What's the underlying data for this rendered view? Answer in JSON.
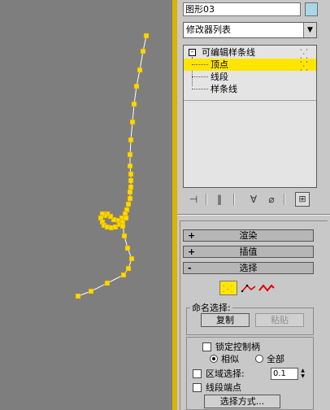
{
  "object_name": "图形03",
  "modifier_list": {
    "label": "修改器列表"
  },
  "stack": {
    "items": [
      {
        "label": "可编辑样条线",
        "toggle": "-"
      },
      {
        "label": "顶点"
      },
      {
        "label": "线段"
      },
      {
        "label": "样条线"
      }
    ]
  },
  "rollouts": [
    {
      "sign": "+",
      "label": "渲染"
    },
    {
      "sign": "+",
      "label": "插值"
    },
    {
      "sign": "-",
      "label": "选择"
    }
  ],
  "named_selection": {
    "title": "命名选择:",
    "copy_label": "复制",
    "paste_label": "粘贴"
  },
  "options": {
    "lock_handles": "锁定控制柄",
    "similar": "相似",
    "all": "全部",
    "area_select": "区域选择:",
    "area_value": "0.1",
    "segment_end": "线段端点",
    "select_by": "选择方式..."
  },
  "colors": {
    "viewport_bg": "#7e7e7e",
    "active_border": "#d6b400",
    "selection_yellow": "#ffe600",
    "vertex_color": "#ffd800",
    "spline_color": "#ffffff"
  },
  "curve": {
    "points": [
      [
        180,
        44
      ],
      [
        176,
        63
      ],
      [
        172,
        86
      ],
      [
        168,
        106
      ],
      [
        165,
        128
      ],
      [
        163,
        150
      ],
      [
        161,
        172
      ],
      [
        160,
        190
      ],
      [
        160,
        204
      ],
      [
        161,
        214
      ],
      [
        161,
        222
      ],
      [
        161,
        230
      ],
      [
        160,
        236
      ],
      [
        160,
        244
      ],
      [
        158,
        251
      ],
      [
        156,
        258
      ],
      [
        154,
        263
      ],
      [
        150,
        268
      ],
      [
        145,
        271
      ],
      [
        140,
        270
      ],
      [
        136,
        266
      ],
      [
        132,
        263
      ],
      [
        129,
        265
      ],
      [
        126,
        263
      ],
      [
        124,
        268
      ],
      [
        126,
        273
      ],
      [
        128,
        277
      ],
      [
        132,
        279
      ],
      [
        137,
        280
      ],
      [
        142,
        279
      ],
      [
        147,
        276
      ],
      [
        151,
        273
      ],
      [
        155,
        268
      ],
      [
        151,
        278
      ],
      [
        153,
        290
      ],
      [
        157,
        305
      ],
      [
        162,
        318
      ],
      [
        158,
        330
      ],
      [
        152,
        338
      ],
      [
        132,
        348
      ],
      [
        112,
        358
      ],
      [
        96,
        364
      ]
    ]
  }
}
